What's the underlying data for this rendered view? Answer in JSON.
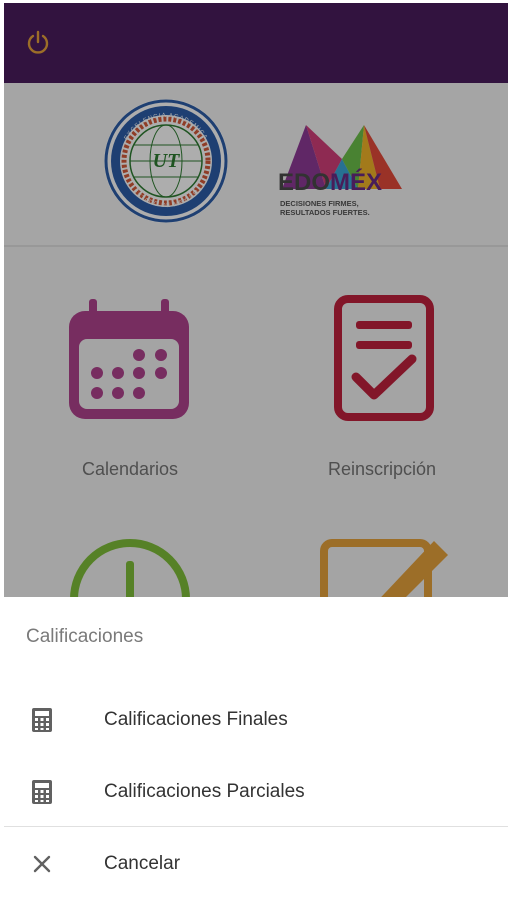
{
  "appbar": {
    "color": "#4b1d5e",
    "power_icon": "power-icon"
  },
  "logos": {
    "seal_text_top": "EXCELENCIA ACADEMICA",
    "seal_text_bottom": "ESTADO DE MEXICO",
    "seal_monogram": "UT",
    "edomex_word_part1": "EDO",
    "edomex_word_part2": "MÉX",
    "edomex_slogan_line1": "DECISIONES FIRMES,",
    "edomex_slogan_line2": "RESULTADOS FUERTES."
  },
  "menu": {
    "items": [
      {
        "label": "Calendarios",
        "icon": "calendar-icon",
        "color": "#b0438e"
      },
      {
        "label": "Reinscripción",
        "icon": "checklist-icon",
        "color": "#c0213d"
      },
      {
        "label": "",
        "icon": "clock-icon",
        "color": "#7fbf3a"
      },
      {
        "label": "",
        "icon": "edit-icon",
        "color": "#e6a23c"
      }
    ]
  },
  "sheet": {
    "title": "Calificaciones",
    "items": [
      {
        "label": "Calificaciones Finales",
        "icon": "calculator-icon"
      },
      {
        "label": "Calificaciones Parciales",
        "icon": "calculator-icon"
      }
    ],
    "cancel": {
      "label": "Cancelar",
      "icon": "close-icon"
    }
  }
}
